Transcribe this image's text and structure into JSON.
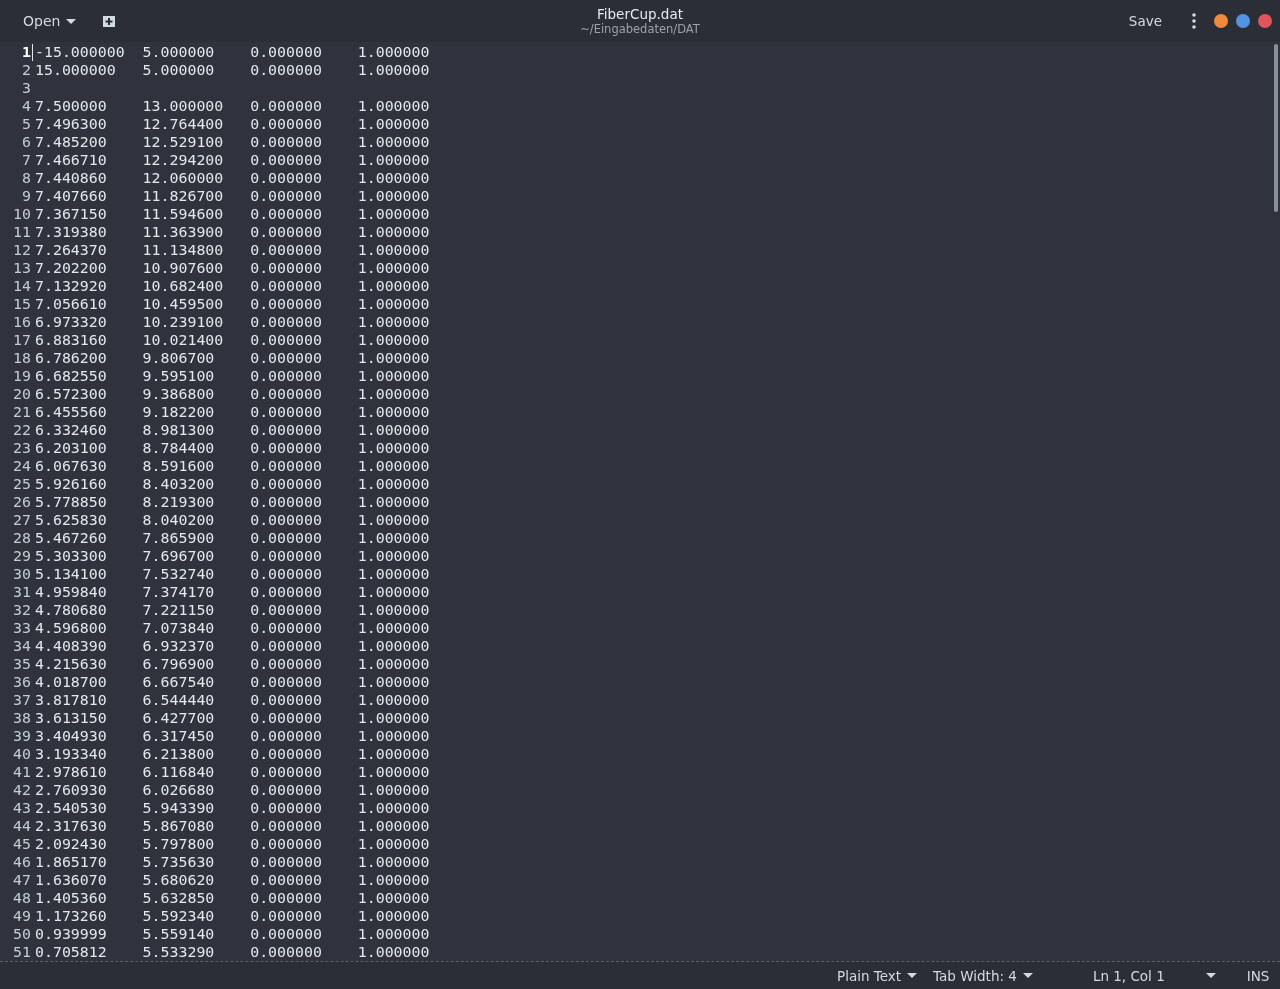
{
  "header": {
    "open_button": "Open",
    "title": "FiberCup.dat",
    "subtitle": "~/Eingabedaten/DAT",
    "save_button": "Save"
  },
  "editor": {
    "lines": [
      {
        "number": "1",
        "text": "-15.000000\t5.000000\t0.000000\t1.000000",
        "current": true
      },
      {
        "number": "2",
        "text": "15.000000\t5.000000\t0.000000\t1.000000",
        "current": false
      },
      {
        "number": "3",
        "current": false
      },
      {
        "number": "4",
        "text": "7.500000\t13.000000\t0.000000\t1.000000",
        "current": false
      },
      {
        "number": "5",
        "text": "7.496300\t12.764400\t0.000000\t1.000000",
        "current": false
      },
      {
        "number": "6",
        "text": "7.485200\t12.529100\t0.000000\t1.000000",
        "current": false
      },
      {
        "number": "7",
        "text": "7.466710\t12.294200\t0.000000\t1.000000",
        "current": false
      },
      {
        "number": "8",
        "text": "7.440860\t12.060000\t0.000000\t1.000000",
        "current": false
      },
      {
        "number": "9",
        "text": "7.407660\t11.826700\t0.000000\t1.000000",
        "current": false
      },
      {
        "number": "10",
        "text": "7.367150\t11.594600\t0.000000\t1.000000",
        "current": false
      },
      {
        "number": "11",
        "text": "7.319380\t11.363900\t0.000000\t1.000000",
        "current": false
      },
      {
        "number": "12",
        "text": "7.264370\t11.134800\t0.000000\t1.000000",
        "current": false
      },
      {
        "number": "13",
        "text": "7.202200\t10.907600\t0.000000\t1.000000",
        "current": false
      },
      {
        "number": "14",
        "text": "7.132920\t10.682400\t0.000000\t1.000000",
        "current": false
      },
      {
        "number": "15",
        "text": "7.056610\t10.459500\t0.000000\t1.000000",
        "current": false
      },
      {
        "number": "16",
        "text": "6.973320\t10.239100\t0.000000\t1.000000",
        "current": false
      },
      {
        "number": "17",
        "text": "6.883160\t10.021400\t0.000000\t1.000000",
        "current": false
      },
      {
        "number": "18",
        "text": "6.786200\t9.806700\t0.000000\t1.000000",
        "current": false
      },
      {
        "number": "19",
        "text": "6.682550\t9.595100\t0.000000\t1.000000",
        "current": false
      },
      {
        "number": "20",
        "text": "6.572300\t9.386800\t0.000000\t1.000000",
        "current": false
      },
      {
        "number": "21",
        "text": "6.455560\t9.182200\t0.000000\t1.000000",
        "current": false
      },
      {
        "number": "22",
        "text": "6.332460\t8.981300\t0.000000\t1.000000",
        "current": false
      },
      {
        "number": "23",
        "text": "6.203100\t8.784400\t0.000000\t1.000000",
        "current": false
      },
      {
        "number": "24",
        "text": "6.067630\t8.591600\t0.000000\t1.000000",
        "current": false
      },
      {
        "number": "25",
        "text": "5.926160\t8.403200\t0.000000\t1.000000",
        "current": false
      },
      {
        "number": "26",
        "text": "5.778850\t8.219300\t0.000000\t1.000000",
        "current": false
      },
      {
        "number": "27",
        "text": "5.625830\t8.040200\t0.000000\t1.000000",
        "current": false
      },
      {
        "number": "28",
        "text": "5.467260\t7.865900\t0.000000\t1.000000",
        "current": false
      },
      {
        "number": "29",
        "text": "5.303300\t7.696700\t0.000000\t1.000000",
        "current": false
      },
      {
        "number": "30",
        "text": "5.134100\t7.532740\t0.000000\t1.000000",
        "current": false
      },
      {
        "number": "31",
        "text": "4.959840\t7.374170\t0.000000\t1.000000",
        "current": false
      },
      {
        "number": "32",
        "text": "4.780680\t7.221150\t0.000000\t1.000000",
        "current": false
      },
      {
        "number": "33",
        "text": "4.596800\t7.073840\t0.000000\t1.000000",
        "current": false
      },
      {
        "number": "34",
        "text": "4.408390\t6.932370\t0.000000\t1.000000",
        "current": false
      },
      {
        "number": "35",
        "text": "4.215630\t6.796900\t0.000000\t1.000000",
        "current": false
      },
      {
        "number": "36",
        "text": "4.018700\t6.667540\t0.000000\t1.000000",
        "current": false
      },
      {
        "number": "37",
        "text": "3.817810\t6.544440\t0.000000\t1.000000",
        "current": false
      },
      {
        "number": "38",
        "text": "3.613150\t6.427700\t0.000000\t1.000000",
        "current": false
      },
      {
        "number": "39",
        "text": "3.404930\t6.317450\t0.000000\t1.000000",
        "current": false
      },
      {
        "number": "40",
        "text": "3.193340\t6.213800\t0.000000\t1.000000",
        "current": false
      },
      {
        "number": "41",
        "text": "2.978610\t6.116840\t0.000000\t1.000000",
        "current": false
      },
      {
        "number": "42",
        "text": "2.760930\t6.026680\t0.000000\t1.000000",
        "current": false
      },
      {
        "number": "43",
        "text": "2.540530\t5.943390\t0.000000\t1.000000",
        "current": false
      },
      {
        "number": "44",
        "text": "2.317630\t5.867080\t0.000000\t1.000000",
        "current": false
      },
      {
        "number": "45",
        "text": "2.092430\t5.797800\t0.000000\t1.000000",
        "current": false
      },
      {
        "number": "46",
        "text": "1.865170\t5.735630\t0.000000\t1.000000",
        "current": false
      },
      {
        "number": "47",
        "text": "1.636070\t5.680620\t0.000000\t1.000000",
        "current": false
      },
      {
        "number": "48",
        "text": "1.405360\t5.632850\t0.000000\t1.000000",
        "current": false
      },
      {
        "number": "49",
        "text": "1.173260\t5.592340\t0.000000\t1.000000",
        "current": false
      },
      {
        "number": "50",
        "text": "0.939999\t5.559140\t0.000000\t1.000000",
        "current": false
      },
      {
        "number": "51",
        "text": "0.705812\t5.533290\t0.000000\t1.000000",
        "current": false
      }
    ]
  },
  "status_bar": {
    "language": "Plain Text",
    "tab_width": "Tab Width: 4",
    "position": "Ln 1, Col 1",
    "mode": "INS"
  }
}
